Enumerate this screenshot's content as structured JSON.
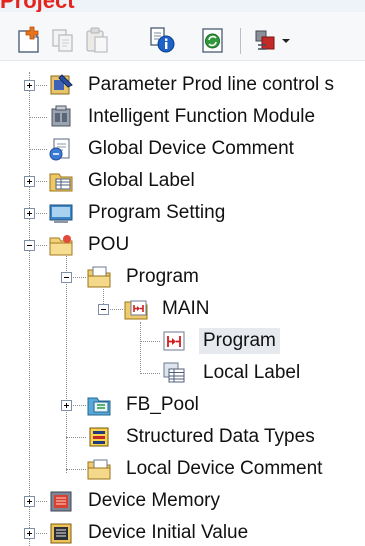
{
  "panel": {
    "title": "Project"
  },
  "toolbar": [
    {
      "name": "new-data-icon"
    },
    {
      "name": "copy-icon"
    },
    {
      "name": "paste-icon"
    },
    {
      "name": "properties-icon"
    },
    {
      "name": "refresh-icon"
    },
    {
      "name": "display-options-icon"
    }
  ],
  "tree": {
    "parameter": "Parameter Prod line control s",
    "intelligent_function_module": "Intelligent Function Module",
    "global_device_comment": "Global Device Comment",
    "global_label": "Global Label",
    "program_setting": "Program Setting",
    "pou": "POU",
    "program_folder": "Program",
    "main": "MAIN",
    "main_program": "Program",
    "local_label": "Local Label",
    "fb_pool": "FB_Pool",
    "structured_data_types": "Structured Data Types",
    "local_device_comment": "Local Device Comment",
    "device_memory": "Device Memory",
    "device_initial_value": "Device Initial Value"
  },
  "colors": {
    "title": "#e3251f",
    "selection": "#e6e9ee"
  }
}
